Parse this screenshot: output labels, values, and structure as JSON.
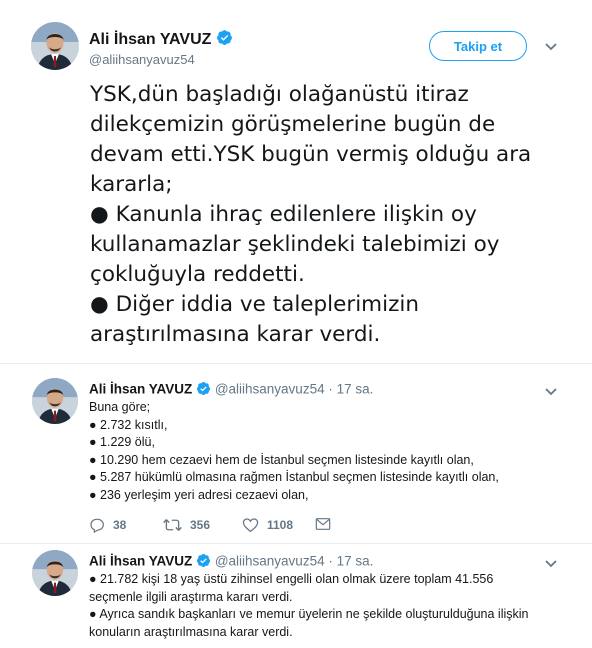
{
  "main_tweet": {
    "author_name": "Ali İhsan YAVUZ",
    "author_handle": "@aliihsanyavuz54",
    "follow_label": "Takip et",
    "text_lines": [
      "YSK,dün başladığı olağanüstü itiraz",
      "dilekçemizin görüşmelerine bugün de",
      "devam etti.YSK bugün vermiş olduğu ara",
      "kararla;",
      "● Kanunla ihraç edilenlere ilişkin oy",
      "kullanamazlar şeklindeki talebimizi oy",
      "çokluğuyla reddetti.",
      "● Diğer iddia ve taleplerimizin",
      "araştırılmasına karar verdi."
    ]
  },
  "replies": [
    {
      "author_name": "Ali İhsan YAVUZ",
      "author_handle": "@aliihsanyavuz54",
      "separator": "·",
      "time": "17 sa.",
      "body_lines": [
        "Buna göre;",
        "● 2.732 kısıtlı,",
        "● 1.229 ölü,",
        "● 10.290 hem cezaevi hem de İstanbul seçmen listesinde kayıtlı olan,",
        "● 5.287 hükümlü olmasına rağmen İstanbul seçmen listesinde kayıtlı olan,",
        "● 236 yerleşim yeri adresi cezaevi olan,"
      ],
      "actions": {
        "replies": "38",
        "retweets": "356",
        "likes": "1108"
      }
    },
    {
      "author_name": "Ali İhsan YAVUZ",
      "author_handle": "@aliihsanyavuz54",
      "separator": "·",
      "time": "17 sa.",
      "body_lines": [
        "● 21.782 kişi 18 yaş üstü zihinsel engelli olan olmak üzere toplam 41.556",
        "seçmenle ilgili araştırma kararı verdi.",
        "● Ayrıca sandık başkanları ve memur üyelerin ne şekilde oluşturulduğuna ilişkin",
        "konuların araştırılmasına karar verdi."
      ]
    }
  ],
  "icons": {
    "verified": "verified-badge-icon",
    "more": "chevron-down-icon",
    "reply": "reply-icon",
    "retweet": "retweet-icon",
    "like": "heart-icon",
    "dm": "envelope-icon"
  },
  "colors": {
    "accent": "#1da1f2",
    "text": "#14171a",
    "secondary": "#657786",
    "divider": "#e6ecf0"
  }
}
